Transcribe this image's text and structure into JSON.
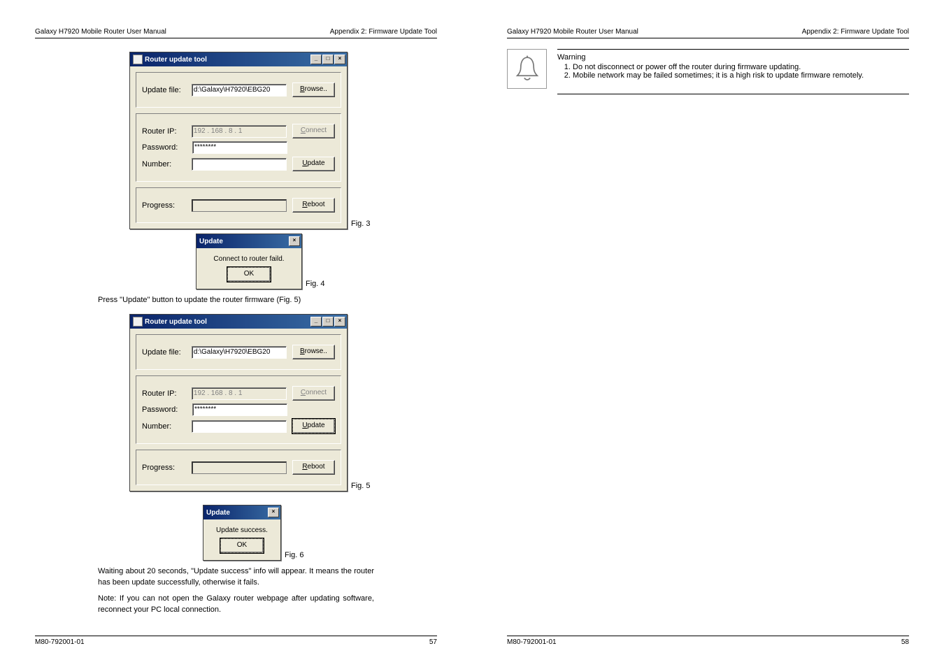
{
  "header": {
    "left": "Galaxy H7920 Mobile Router User Manual",
    "right": "Appendix 2: Firmware Update Tool"
  },
  "footer": {
    "code": "M80-792001-01",
    "page_left": "57",
    "page_right": "58"
  },
  "dialog": {
    "title": "Router update tool",
    "update_file_label": "Update file:",
    "update_file_value": "d:\\Galaxy\\H7920\\EBG20",
    "browse": "Browse..",
    "router_ip_label": "Router IP:",
    "router_ip_value": "192 . 168 .  8  .  1",
    "password_label": "Password:",
    "password_value": "********",
    "number_label": "Number:",
    "number_value": "",
    "progress_label": "Progress:",
    "connect": "Connect",
    "update": "Update",
    "reboot": "Reboot"
  },
  "msgbox_fail": {
    "title": "Update",
    "body": "Connect to router faild.",
    "ok": "OK"
  },
  "msgbox_success": {
    "title": "Update",
    "body": "Update success.",
    "ok": "OK"
  },
  "fig_labels": {
    "fig3": "Fig. 3",
    "fig4": "Fig. 4",
    "fig5": "Fig. 5",
    "fig6": "Fig. 6"
  },
  "body_text": {
    "press_update": "Press \"Update\" button to update the router firmware (Fig. 5)",
    "waiting": "Waiting about 20 seconds, \"Update success\" info will appear. It means the router has been update successfully, otherwise it fails.",
    "note": "Note: If you can not open the Galaxy router webpage after updating software, reconnect your PC local connection."
  },
  "warning": {
    "title": "Warning",
    "items": [
      "Do not disconnect or power off the router during firmware updating.",
      "Mobile network may be failed sometimes; it is a high risk to update firmware remotely."
    ]
  }
}
